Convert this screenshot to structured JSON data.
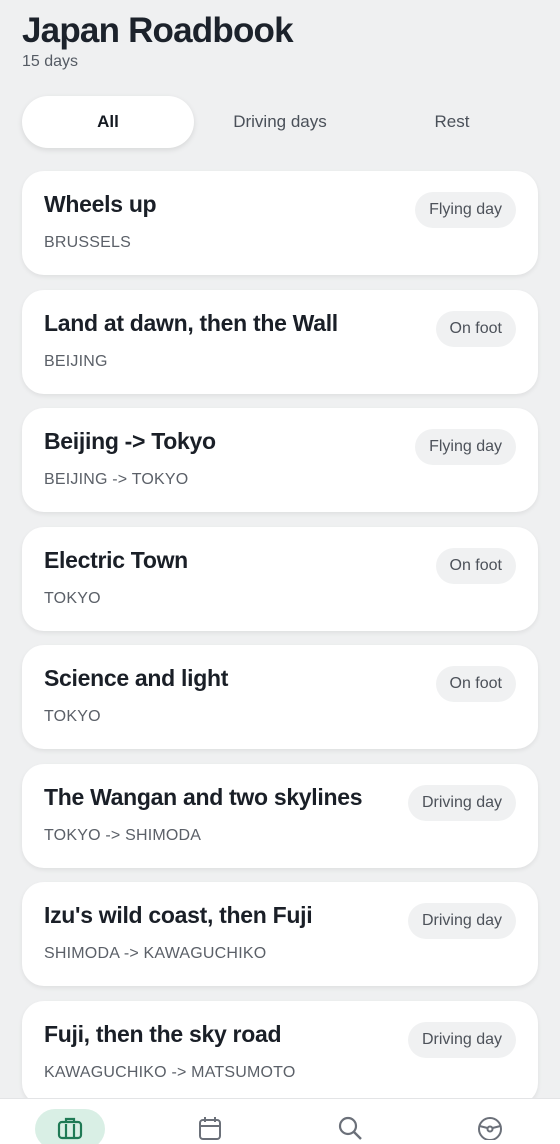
{
  "header": {
    "title": "Japan Roadbook",
    "subtitle": "15 days"
  },
  "filters": [
    {
      "label": "All",
      "selected": true
    },
    {
      "label": "Driving days",
      "selected": false
    },
    {
      "label": "Rest",
      "selected": false
    }
  ],
  "days": [
    {
      "title": "Wheels up",
      "location": "BRUSSELS",
      "badge": "Flying day"
    },
    {
      "title": "Land at dawn, then the Wall",
      "location": "BEIJING",
      "badge": "On foot"
    },
    {
      "title": "Beijing -> Tokyo",
      "location": "BEIJING -> TOKYO",
      "badge": "Flying day"
    },
    {
      "title": "Electric Town",
      "location": "TOKYO",
      "badge": "On foot"
    },
    {
      "title": "Science and light",
      "location": "TOKYO",
      "badge": "On foot"
    },
    {
      "title": "The Wangan and two skylines",
      "location": "TOKYO -> SHIMODA",
      "badge": "Driving day"
    },
    {
      "title": "Izu's wild coast, then Fuji",
      "location": "SHIMODA -> KAWAGUCHIKO",
      "badge": "Driving day"
    },
    {
      "title": "Fuji, then the sky road",
      "location": "KAWAGUCHIKO -> MATSUMOTO",
      "badge": "Driving day"
    }
  ],
  "nav": [
    {
      "icon": "suitcase-icon",
      "active": true
    },
    {
      "icon": "calendar-icon",
      "active": false
    },
    {
      "icon": "search-icon",
      "active": false
    },
    {
      "icon": "steering-wheel-icon",
      "active": false
    }
  ],
  "colors": {
    "accent": "#1f7a55",
    "accent_soft": "#d9efe5",
    "background": "#eff0f1"
  }
}
